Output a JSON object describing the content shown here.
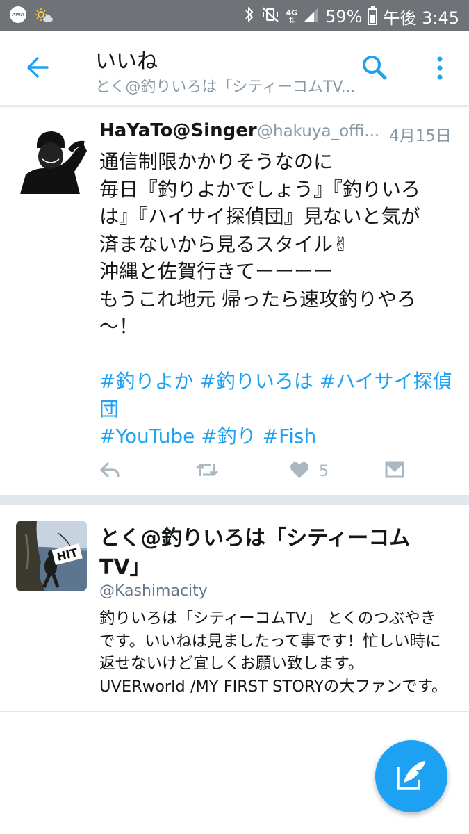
{
  "status_bar": {
    "app_badge": "AWA",
    "network": "4G",
    "battery_percent": "59%",
    "battery_level": 0.59,
    "time": "午後 3:45"
  },
  "header": {
    "title": "いいね",
    "subtitle": "とく@釣りいろは「シティーコムTV...",
    "icons": [
      "back-arrow-icon",
      "search-icon",
      "more-vertical-icon"
    ]
  },
  "tweet": {
    "name": "HaYaTo@Singer",
    "handle": "@hakuya_offi...",
    "date": "4月15日",
    "text_lines": [
      "通信制限かかりそうなのに",
      "毎日『釣りよかでしょう』『釣りいろ",
      "は』『ハイサイ探偵団』見ないと気が",
      "済まないから見るスタイル✌",
      "沖縄と佐賀行きてーーーー",
      "もうこれ地元 帰ったら速攻釣りやろ",
      "〜！"
    ],
    "hashtags_line1": [
      "#釣りよか",
      "#釣りいろは",
      "#ハイサイ探偵"
    ],
    "hashtags_line2": [
      "団"
    ],
    "hashtags_line3": [
      "#YouTube",
      "#釣り",
      "#Fish"
    ],
    "like_count": "5",
    "action_icons": [
      "reply-icon",
      "retweet-icon",
      "like-icon",
      "direct-message-icon"
    ]
  },
  "user_card": {
    "name_line1": "とく@釣りいろは「シティーコム",
    "name_line2": "TV」",
    "handle": "@Kashimacity",
    "bio_lines": [
      "釣りいろは「シティーコムTV」 とくのつぶやき",
      "です。いいねは見ましたって事です！忙しい時に",
      "返せないけど宜しくお願い致します。",
      "UVERworld /MY FIRST STORYの大ファンです。"
    ],
    "avatar_text": "HIT"
  },
  "fab": {
    "icon": "compose-tweet-icon"
  },
  "colors": {
    "accent": "#1da1f2",
    "status_bar": "#6f7378",
    "secondary_text": "#8899a6",
    "action_gray": "#aab8c2",
    "divider": "#e1e8ed"
  }
}
